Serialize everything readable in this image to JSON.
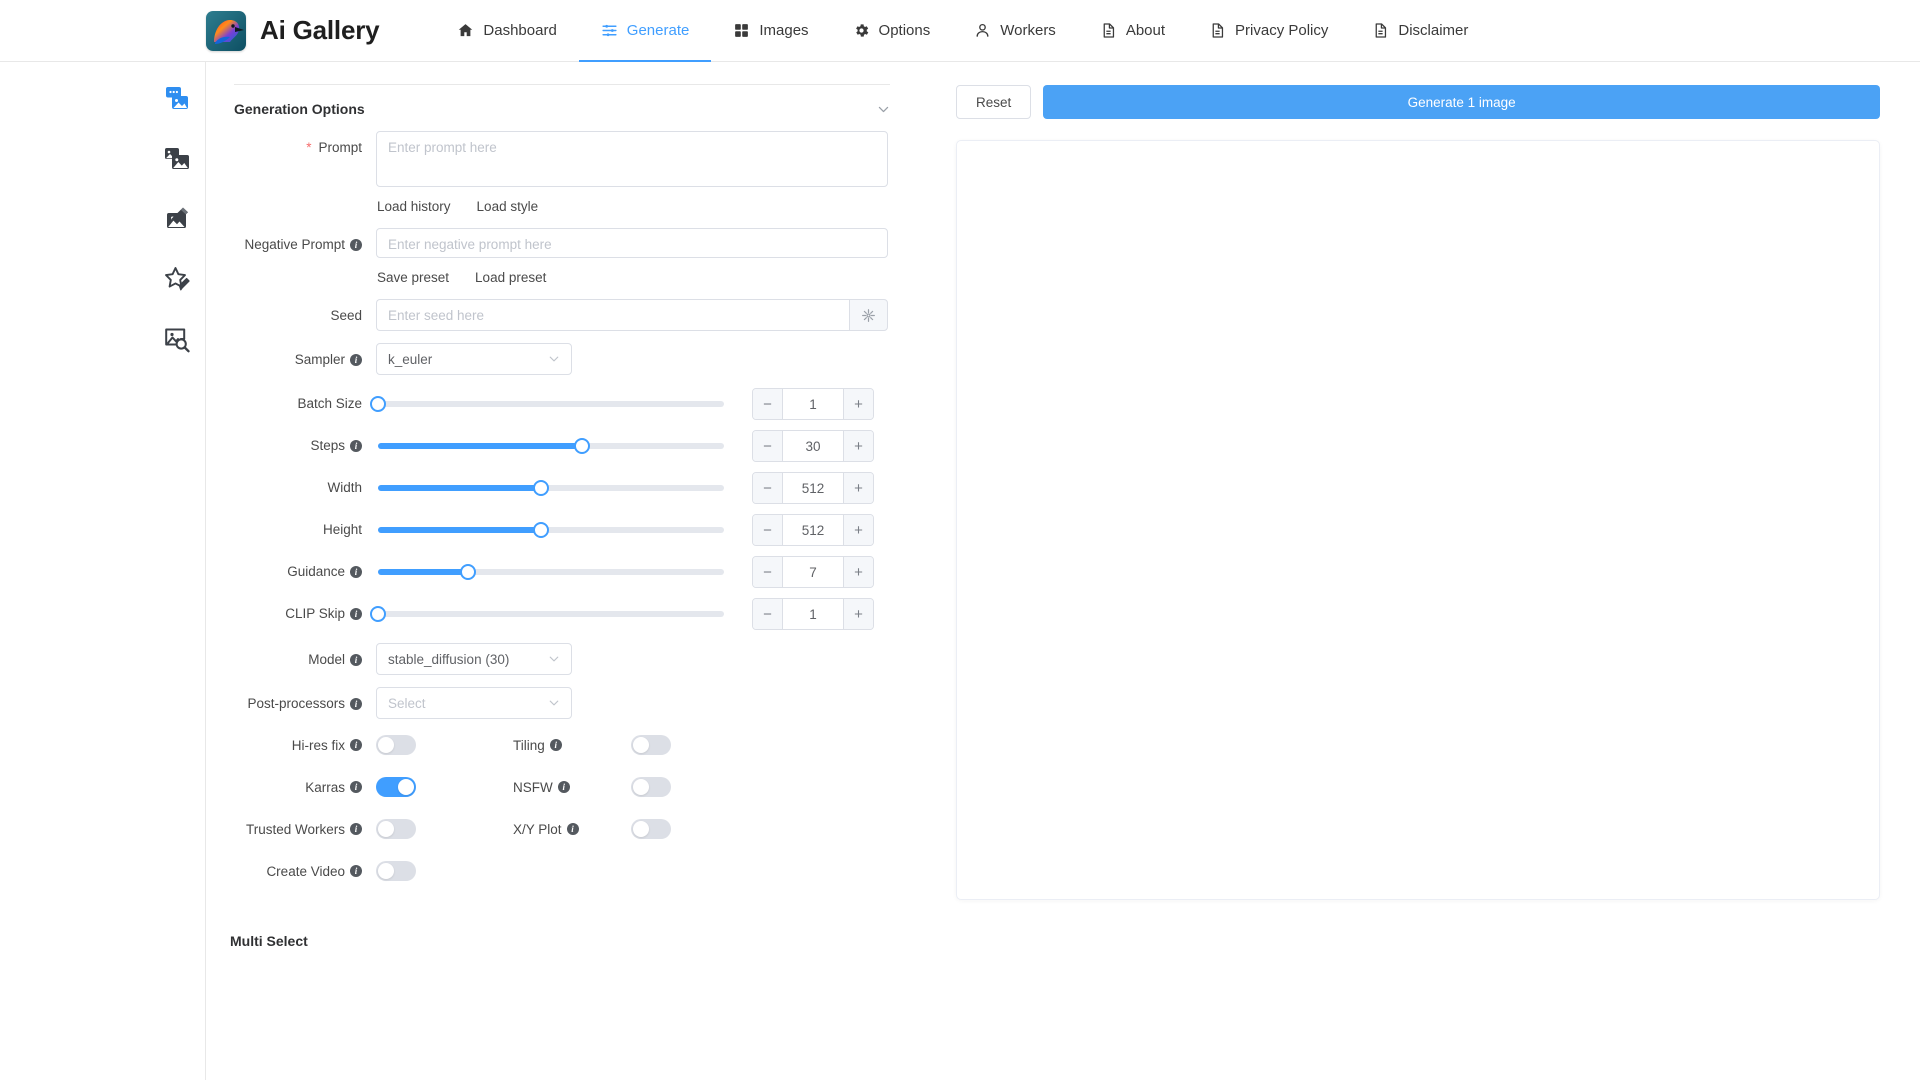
{
  "app": {
    "brand_title": "Ai Gallery",
    "logo_icon": "bird-logo-icon"
  },
  "nav": {
    "items": [
      {
        "label": "Dashboard",
        "icon": "home-icon",
        "active": false
      },
      {
        "label": "Generate",
        "icon": "sliders-icon",
        "active": true
      },
      {
        "label": "Images",
        "icon": "grid-icon",
        "active": false
      },
      {
        "label": "Options",
        "icon": "gear-icon",
        "active": false
      },
      {
        "label": "Workers",
        "icon": "user-icon",
        "active": false
      },
      {
        "label": "About",
        "icon": "document-icon",
        "active": false
      },
      {
        "label": "Privacy Policy",
        "icon": "document-icon",
        "active": false
      },
      {
        "label": "Disclaimer",
        "icon": "document-icon",
        "active": false
      }
    ]
  },
  "sidebar": {
    "items": [
      {
        "name": "text-to-image",
        "icon": "chat-image-icon",
        "active": true
      },
      {
        "name": "image-to-image",
        "icon": "stacked-images-icon",
        "active": false
      },
      {
        "name": "inpainting",
        "icon": "image-edit-icon",
        "active": false
      },
      {
        "name": "rating",
        "icon": "star-pencil-icon",
        "active": false
      },
      {
        "name": "interrogate",
        "icon": "image-search-icon",
        "active": false
      }
    ]
  },
  "form": {
    "section_title": "Generation Options",
    "collapse_icon": "chevron-down-icon",
    "prompt": {
      "label": "Prompt",
      "required_marker": "*",
      "placeholder": "Enter prompt here",
      "value": "",
      "actions": [
        "Load history",
        "Load style"
      ]
    },
    "negative_prompt": {
      "label": "Negative Prompt",
      "info_icon": "info-icon",
      "placeholder": "Enter negative prompt here",
      "value": "",
      "actions": [
        "Save preset",
        "Load preset"
      ]
    },
    "seed": {
      "label": "Seed",
      "placeholder": "Enter seed here",
      "value": "",
      "append_icon": "dice-random-icon"
    },
    "sampler": {
      "label": "Sampler",
      "info_icon": "info-icon",
      "value": "k_euler",
      "chevron_icon": "chevron-down-icon"
    },
    "sliders": [
      {
        "label": "Batch Size",
        "info": false,
        "value": "1",
        "percent": 0
      },
      {
        "label": "Steps",
        "info": true,
        "value": "30",
        "percent": 59
      },
      {
        "label": "Width",
        "info": false,
        "value": "512",
        "percent": 47
      },
      {
        "label": "Height",
        "info": false,
        "value": "512",
        "percent": 47
      },
      {
        "label": "Guidance",
        "info": true,
        "value": "7",
        "percent": 26
      },
      {
        "label": "CLIP Skip",
        "info": true,
        "value": "1",
        "percent": 0
      }
    ],
    "stepper_minus": "−",
    "stepper_plus": "+",
    "model": {
      "label": "Model",
      "info_icon": "info-icon",
      "value": "stable_diffusion (30)",
      "chevron_icon": "chevron-down-icon"
    },
    "post_processors": {
      "label": "Post-processors",
      "info_icon": "info-icon",
      "placeholder": "Select",
      "value": "",
      "chevron_icon": "chevron-down-icon"
    },
    "switch_rows": [
      {
        "left": {
          "label": "Hi-res fix",
          "on": false
        },
        "right": {
          "label": "Tiling",
          "on": false
        }
      },
      {
        "left": {
          "label": "Karras",
          "on": true
        },
        "right": {
          "label": "NSFW",
          "on": false
        }
      },
      {
        "left": {
          "label": "Trusted Workers",
          "on": false
        },
        "right": {
          "label": "X/Y Plot",
          "on": false
        }
      },
      {
        "left": {
          "label": "Create Video",
          "on": false
        },
        "right": null
      }
    ],
    "multi_select_title": "Multi Select"
  },
  "actions": {
    "reset_label": "Reset",
    "generate_label": "Generate 1 image",
    "generate_color": "#4ba2f5"
  },
  "preview": {
    "content": ""
  }
}
